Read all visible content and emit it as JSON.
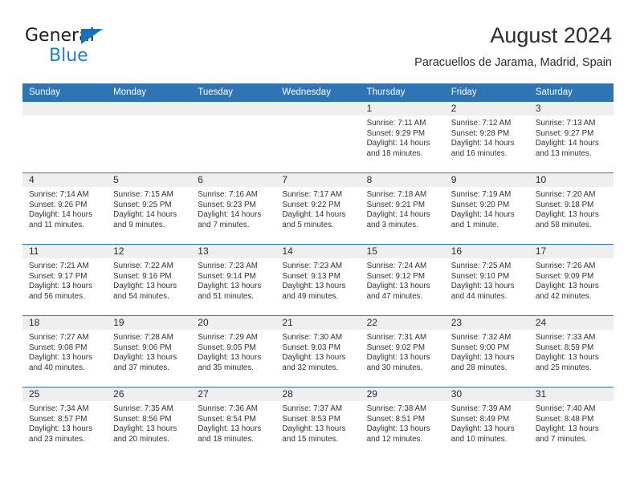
{
  "brand": {
    "line1": "General",
    "line2": "Blue",
    "logo_icon": "triangle-flag-icon",
    "accent_color": "#1f7ec4"
  },
  "header": {
    "month_title": "August 2024",
    "location": "Paracuellos de Jarama, Madrid, Spain"
  },
  "colors": {
    "header_blue": "#2f74b5",
    "daynum_band": "#efefef",
    "text": "#2b2b2b"
  },
  "calendar": {
    "weekday_headers": [
      "Sunday",
      "Monday",
      "Tuesday",
      "Wednesday",
      "Thursday",
      "Friday",
      "Saturday"
    ],
    "labels": {
      "sunrise": "Sunrise:",
      "sunset": "Sunset:",
      "daylight": "Daylight:"
    },
    "weeks": [
      [
        {
          "day": "",
          "empty": true
        },
        {
          "day": "",
          "empty": true
        },
        {
          "day": "",
          "empty": true
        },
        {
          "day": "",
          "empty": true
        },
        {
          "day": "1",
          "sunrise": "Sunrise: 7:11 AM",
          "sunset": "Sunset: 9:29 PM",
          "daylight": "Daylight: 14 hours and 18 minutes."
        },
        {
          "day": "2",
          "sunrise": "Sunrise: 7:12 AM",
          "sunset": "Sunset: 9:28 PM",
          "daylight": "Daylight: 14 hours and 16 minutes."
        },
        {
          "day": "3",
          "sunrise": "Sunrise: 7:13 AM",
          "sunset": "Sunset: 9:27 PM",
          "daylight": "Daylight: 14 hours and 13 minutes."
        }
      ],
      [
        {
          "day": "4",
          "sunrise": "Sunrise: 7:14 AM",
          "sunset": "Sunset: 9:26 PM",
          "daylight": "Daylight: 14 hours and 11 minutes."
        },
        {
          "day": "5",
          "sunrise": "Sunrise: 7:15 AM",
          "sunset": "Sunset: 9:25 PM",
          "daylight": "Daylight: 14 hours and 9 minutes."
        },
        {
          "day": "6",
          "sunrise": "Sunrise: 7:16 AM",
          "sunset": "Sunset: 9:23 PM",
          "daylight": "Daylight: 14 hours and 7 minutes."
        },
        {
          "day": "7",
          "sunrise": "Sunrise: 7:17 AM",
          "sunset": "Sunset: 9:22 PM",
          "daylight": "Daylight: 14 hours and 5 minutes."
        },
        {
          "day": "8",
          "sunrise": "Sunrise: 7:18 AM",
          "sunset": "Sunset: 9:21 PM",
          "daylight": "Daylight: 14 hours and 3 minutes."
        },
        {
          "day": "9",
          "sunrise": "Sunrise: 7:19 AM",
          "sunset": "Sunset: 9:20 PM",
          "daylight": "Daylight: 14 hours and 1 minute."
        },
        {
          "day": "10",
          "sunrise": "Sunrise: 7:20 AM",
          "sunset": "Sunset: 9:18 PM",
          "daylight": "Daylight: 13 hours and 58 minutes."
        }
      ],
      [
        {
          "day": "11",
          "sunrise": "Sunrise: 7:21 AM",
          "sunset": "Sunset: 9:17 PM",
          "daylight": "Daylight: 13 hours and 56 minutes."
        },
        {
          "day": "12",
          "sunrise": "Sunrise: 7:22 AM",
          "sunset": "Sunset: 9:16 PM",
          "daylight": "Daylight: 13 hours and 54 minutes."
        },
        {
          "day": "13",
          "sunrise": "Sunrise: 7:23 AM",
          "sunset": "Sunset: 9:14 PM",
          "daylight": "Daylight: 13 hours and 51 minutes."
        },
        {
          "day": "14",
          "sunrise": "Sunrise: 7:23 AM",
          "sunset": "Sunset: 9:13 PM",
          "daylight": "Daylight: 13 hours and 49 minutes."
        },
        {
          "day": "15",
          "sunrise": "Sunrise: 7:24 AM",
          "sunset": "Sunset: 9:12 PM",
          "daylight": "Daylight: 13 hours and 47 minutes."
        },
        {
          "day": "16",
          "sunrise": "Sunrise: 7:25 AM",
          "sunset": "Sunset: 9:10 PM",
          "daylight": "Daylight: 13 hours and 44 minutes."
        },
        {
          "day": "17",
          "sunrise": "Sunrise: 7:26 AM",
          "sunset": "Sunset: 9:09 PM",
          "daylight": "Daylight: 13 hours and 42 minutes."
        }
      ],
      [
        {
          "day": "18",
          "sunrise": "Sunrise: 7:27 AM",
          "sunset": "Sunset: 9:08 PM",
          "daylight": "Daylight: 13 hours and 40 minutes."
        },
        {
          "day": "19",
          "sunrise": "Sunrise: 7:28 AM",
          "sunset": "Sunset: 9:06 PM",
          "daylight": "Daylight: 13 hours and 37 minutes."
        },
        {
          "day": "20",
          "sunrise": "Sunrise: 7:29 AM",
          "sunset": "Sunset: 9:05 PM",
          "daylight": "Daylight: 13 hours and 35 minutes."
        },
        {
          "day": "21",
          "sunrise": "Sunrise: 7:30 AM",
          "sunset": "Sunset: 9:03 PM",
          "daylight": "Daylight: 13 hours and 32 minutes."
        },
        {
          "day": "22",
          "sunrise": "Sunrise: 7:31 AM",
          "sunset": "Sunset: 9:02 PM",
          "daylight": "Daylight: 13 hours and 30 minutes."
        },
        {
          "day": "23",
          "sunrise": "Sunrise: 7:32 AM",
          "sunset": "Sunset: 9:00 PM",
          "daylight": "Daylight: 13 hours and 28 minutes."
        },
        {
          "day": "24",
          "sunrise": "Sunrise: 7:33 AM",
          "sunset": "Sunset: 8:59 PM",
          "daylight": "Daylight: 13 hours and 25 minutes."
        }
      ],
      [
        {
          "day": "25",
          "sunrise": "Sunrise: 7:34 AM",
          "sunset": "Sunset: 8:57 PM",
          "daylight": "Daylight: 13 hours and 23 minutes."
        },
        {
          "day": "26",
          "sunrise": "Sunrise: 7:35 AM",
          "sunset": "Sunset: 8:56 PM",
          "daylight": "Daylight: 13 hours and 20 minutes."
        },
        {
          "day": "27",
          "sunrise": "Sunrise: 7:36 AM",
          "sunset": "Sunset: 8:54 PM",
          "daylight": "Daylight: 13 hours and 18 minutes."
        },
        {
          "day": "28",
          "sunrise": "Sunrise: 7:37 AM",
          "sunset": "Sunset: 8:53 PM",
          "daylight": "Daylight: 13 hours and 15 minutes."
        },
        {
          "day": "29",
          "sunrise": "Sunrise: 7:38 AM",
          "sunset": "Sunset: 8:51 PM",
          "daylight": "Daylight: 13 hours and 12 minutes."
        },
        {
          "day": "30",
          "sunrise": "Sunrise: 7:39 AM",
          "sunset": "Sunset: 8:49 PM",
          "daylight": "Daylight: 13 hours and 10 minutes."
        },
        {
          "day": "31",
          "sunrise": "Sunrise: 7:40 AM",
          "sunset": "Sunset: 8:48 PM",
          "daylight": "Daylight: 13 hours and 7 minutes."
        }
      ]
    ]
  }
}
